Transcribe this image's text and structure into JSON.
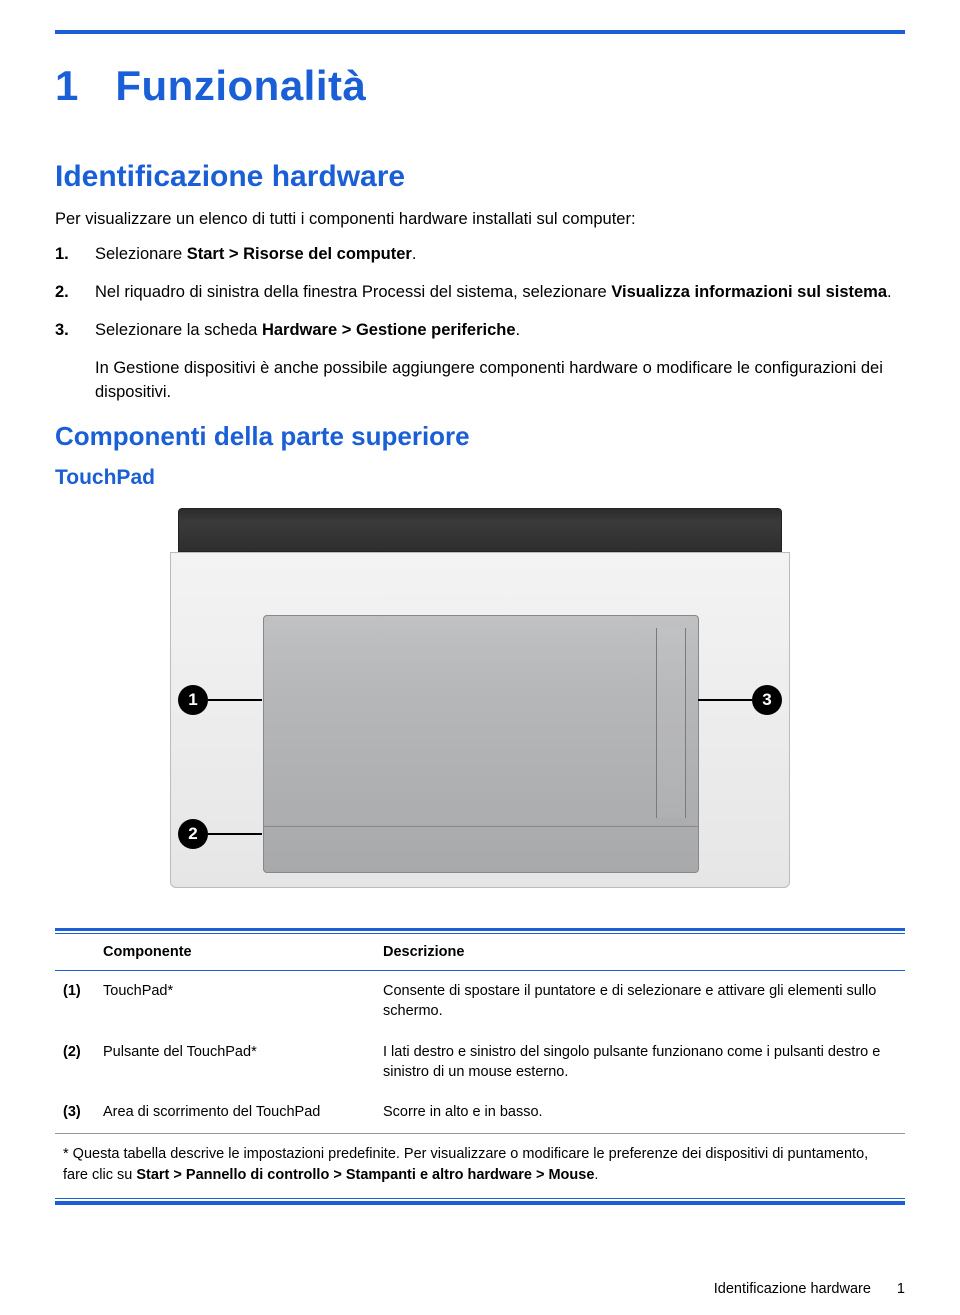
{
  "chapter": {
    "number": "1",
    "title": "Funzionalità"
  },
  "section1": {
    "title": "Identificazione hardware",
    "intro": "Per visualizzare un elenco di tutti i componenti hardware installati sul computer:",
    "steps": [
      {
        "num": "1.",
        "text_before": "Selezionare ",
        "bold": "Start > Risorse del computer",
        "text_after": "."
      },
      {
        "num": "2.",
        "text_before": "Nel riquadro di sinistra della finestra Processi del sistema, selezionare ",
        "bold": "Visualizza informazioni sul sistema",
        "text_after": "."
      },
      {
        "num": "3.",
        "text_before": "Selezionare la scheda ",
        "bold": "Hardware > Gestione periferiche",
        "text_after": "."
      }
    ],
    "note_after": "In Gestione dispositivi è anche possibile aggiungere componenti hardware o modificare le configurazioni dei dispositivi."
  },
  "section2": {
    "title": "Componenti della parte superiore",
    "sub": "TouchPad"
  },
  "callouts": {
    "c1": "1",
    "c2": "2",
    "c3": "3"
  },
  "table": {
    "headers": {
      "component": "Componente",
      "description": "Descrizione"
    },
    "rows": [
      {
        "num": "(1)",
        "name": "TouchPad*",
        "desc": "Consente di spostare il puntatore e di selezionare e attivare gli elementi sullo schermo."
      },
      {
        "num": "(2)",
        "name": "Pulsante del TouchPad*",
        "desc": "I lati destro e sinistro del singolo pulsante funzionano come i pulsanti destro e sinistro di un mouse esterno."
      },
      {
        "num": "(3)",
        "name": "Area di scorrimento del TouchPad",
        "desc": "Scorre in alto e in basso."
      }
    ],
    "footnote": {
      "text_before": "* Questa tabella descrive le impostazioni predefinite. Per visualizzare o modificare le preferenze dei dispositivi di puntamento, fare clic su ",
      "bold": "Start > Pannello di controllo > Stampanti e altro hardware > Mouse",
      "text_after": "."
    }
  },
  "footer": {
    "section": "Identificazione hardware",
    "page": "1"
  }
}
